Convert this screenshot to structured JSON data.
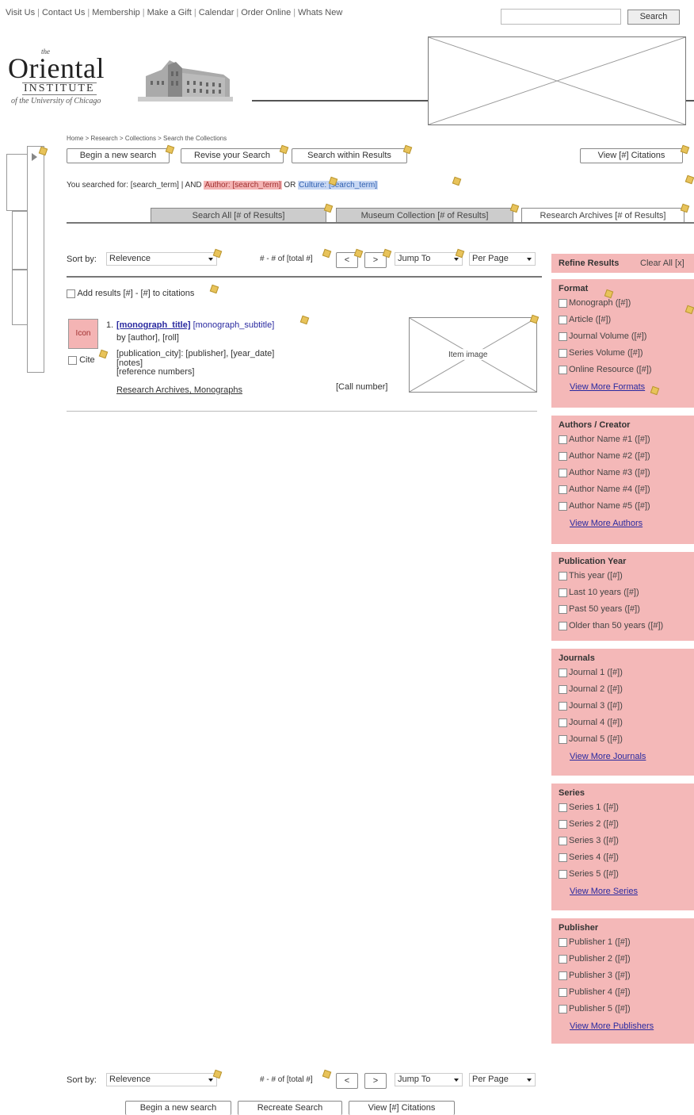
{
  "topnav": [
    "Visit Us",
    "Contact Us",
    "Membership",
    "Make a Gift",
    "Calendar",
    "Order Online",
    "Whats New"
  ],
  "topsearch": {
    "button": "Search"
  },
  "logo": {
    "the": "the",
    "title": "Oriental",
    "institute": "INSTITUTE",
    "university": "of the University of Chicago"
  },
  "breadcrumb": "Home > Research > Collections > Search the Collections",
  "actions_top": {
    "new_search": "Begin a new search",
    "revise": "Revise your Search",
    "within": "Search within Results",
    "view_citations": "View [#] Citations"
  },
  "searched": {
    "prefix": "You searched for: [search_term] | AND ",
    "author_label": "Author: [search_term]",
    "or": " OR ",
    "culture_label": "Culture: [search_term]"
  },
  "tabs": [
    "Search All [# of Results]",
    "Museum Collection [# of Results]",
    "Research Archives [# of Results]"
  ],
  "sortbar": {
    "sort_label": "Sort by:",
    "sort_value": "Relevence",
    "range": "# - # of [total #]",
    "prev": "<",
    "next": ">",
    "jump": "Jump To",
    "per_page": "Per Page"
  },
  "add_results": "Add results [#] - [#] to citations",
  "result": {
    "number": "1.",
    "icon": "Icon",
    "title": "[monograph_title]",
    "subtitle": "[monograph_subtitle]",
    "by": "by [author], [roll]",
    "pub": "[publication_city]: [publisher], [year_date]",
    "notes": "[notes]",
    "refnums": "[reference numbers]",
    "cite": "Cite",
    "collection_link": "Research Archives, Monographs",
    "call_number": "[Call number]",
    "image_label": "Item image"
  },
  "refine": {
    "title": "Refine Results",
    "clear": "Clear All [x]",
    "groups": [
      {
        "title": "Format",
        "items": [
          "Monograph ([#])",
          "Article ([#])",
          "Journal Volume ([#])",
          "Series Volume ([#])",
          "Online Resource ([#])"
        ],
        "more": "View More Formats"
      },
      {
        "title": "Authors / Creator",
        "items": [
          "Author Name #1 ([#])",
          "Author Name #2 ([#])",
          "Author Name #3 ([#])",
          "Author Name #4 ([#])",
          "Author Name #5 ([#])"
        ],
        "more": "View More Authors"
      },
      {
        "title": "Publication Year",
        "items": [
          "This year ([#])",
          "Last 10 years ([#])",
          "Past 50 years ([#])",
          "Older than 50 years ([#])"
        ],
        "more": ""
      },
      {
        "title": "Journals",
        "items": [
          "Journal 1 ([#])",
          "Journal 2 ([#])",
          "Journal 3 ([#])",
          "Journal 4 ([#])",
          "Journal 5 ([#])"
        ],
        "more": "View More Journals"
      },
      {
        "title": "Series",
        "items": [
          "Series 1 ([#])",
          "Series 2 ([#])",
          "Series 3 ([#])",
          "Series 4 ([#])",
          "Series 5 ([#])"
        ],
        "more": "View More Series"
      },
      {
        "title": "Publisher",
        "items": [
          "Publisher 1 ([#])",
          "Publisher 2 ([#])",
          "Publisher 3 ([#])",
          "Publisher 4 ([#])",
          "Publisher 5 ([#])"
        ],
        "more": "View More Publishers"
      }
    ]
  },
  "actions_bottom": {
    "new_search": "Begin a new search",
    "recreate": "Recreate Search",
    "view_citations": "View [#] Citations"
  }
}
